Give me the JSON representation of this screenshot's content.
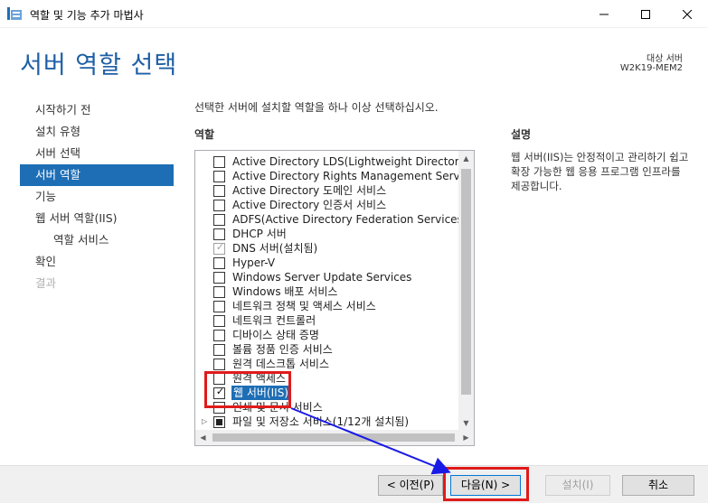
{
  "window": {
    "title": "역할 및 기능 추가 마법사",
    "minimize_label": "―",
    "maximize_label": "☐",
    "close_label": "✕"
  },
  "header": {
    "title": "서버 역할 선택",
    "destination_label": "대상 서버",
    "destination_value": "W2K19-MEM2"
  },
  "nav": {
    "items": [
      {
        "label": "시작하기 전"
      },
      {
        "label": "설치 유형"
      },
      {
        "label": "서버 선택"
      },
      {
        "label": "서버 역할"
      },
      {
        "label": "기능"
      },
      {
        "label": "웹 서버 역할(IIS)"
      },
      {
        "label": "역할 서비스"
      },
      {
        "label": "확인"
      },
      {
        "label": "결과"
      }
    ]
  },
  "main": {
    "instruction": "선택한 서버에 설치할 역할을 하나 이상 선택하십시오.",
    "roles_heading": "역할",
    "roles": [
      {
        "label": "Active Directory LDS(Lightweight Directory Servic",
        "checked": false
      },
      {
        "label": "Active Directory Rights Management Services",
        "checked": false
      },
      {
        "label": "Active Directory 도메인 서비스",
        "checked": false
      },
      {
        "label": "Active Directory 인증서 서비스",
        "checked": false
      },
      {
        "label": "ADFS(Active Directory Federation Services)",
        "checked": false
      },
      {
        "label": "DHCP 서버",
        "checked": false
      },
      {
        "label": "DNS 서버(설치됨)",
        "checked": true,
        "installed": true
      },
      {
        "label": "Hyper-V",
        "checked": false
      },
      {
        "label": "Windows Server Update Services",
        "checked": false
      },
      {
        "label": "Windows 배포 서비스",
        "checked": false
      },
      {
        "label": "네트워크 정책 및 액세스 서비스",
        "checked": false
      },
      {
        "label": "네트워크 컨트롤러",
        "checked": false
      },
      {
        "label": "디바이스 상태 증명",
        "checked": false
      },
      {
        "label": "볼륨 정품 인증 서비스",
        "checked": false
      },
      {
        "label": "원격 데스크톱 서비스",
        "checked": false
      },
      {
        "label": "원격 액세스",
        "checked": false
      },
      {
        "label": "웹 서버(IIS)",
        "checked": true,
        "selected": true
      },
      {
        "label": "인쇄 및 문서 서비스",
        "checked": false
      },
      {
        "label": "파일 및 저장소 서비스(1/12개 설치됨)",
        "checked": "partial",
        "expandable": true
      }
    ],
    "description_heading": "설명",
    "description_text": "웹 서버(IIS)는 안정적이고 관리하기 쉽고 확장 가능한 웹 응용 프로그램 인프라를 제공합니다."
  },
  "footer": {
    "prev_label": "< 이전(P)",
    "next_label": "다음(N) >",
    "install_label": "설치(I)",
    "cancel_label": "취소"
  },
  "colors": {
    "accent": "#1e6eb5",
    "title_blue": "#1f5fa6",
    "annotation_red": "#e01a1a",
    "annotation_arrow": "#1a1ae6"
  }
}
